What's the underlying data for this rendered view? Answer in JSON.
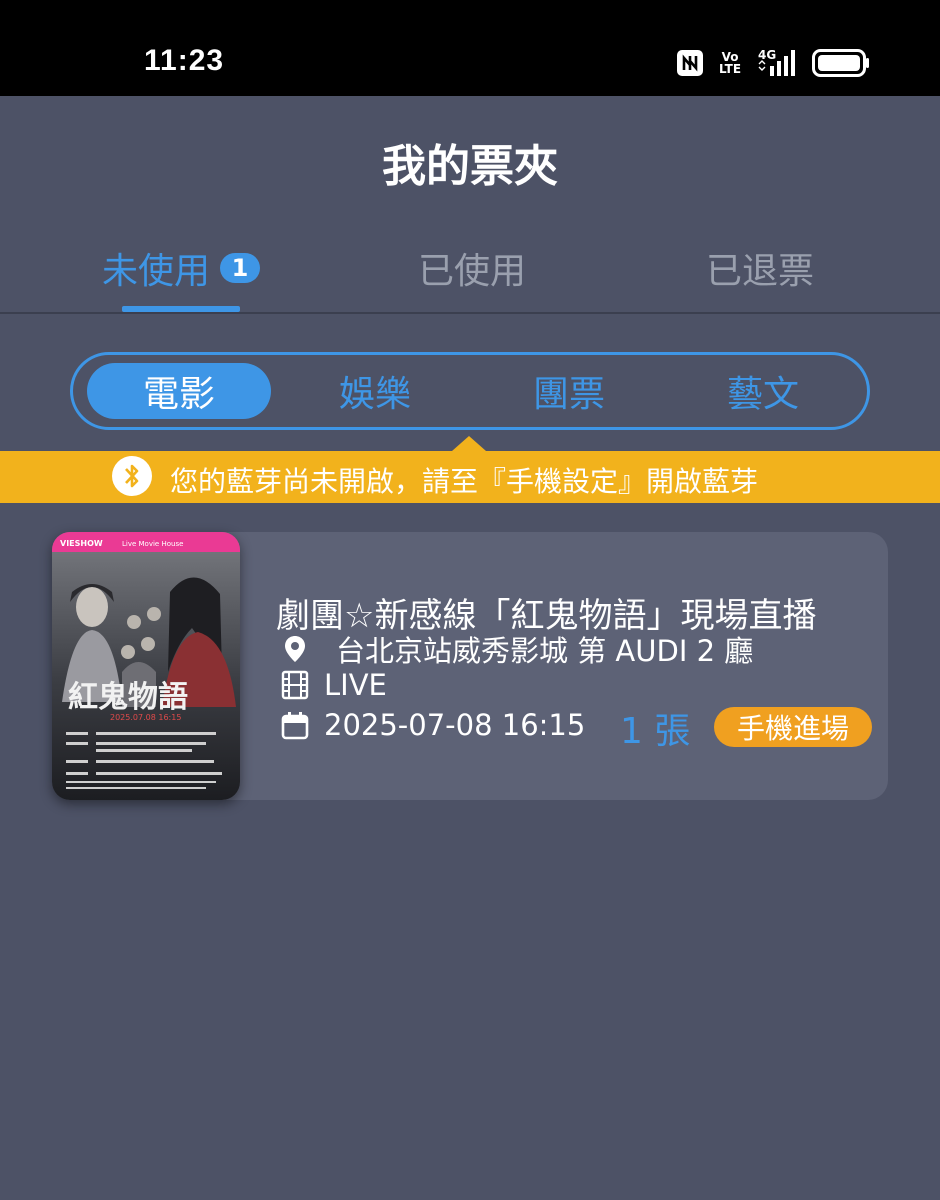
{
  "status_bar": {
    "time": "11:23",
    "network_lines": [
      "Vo",
      "LTE"
    ],
    "signal_label": "4G",
    "icons": [
      "nfc-icon",
      "volte-icon",
      "signal-icon",
      "battery-icon"
    ]
  },
  "header": {
    "title": "我的票夾"
  },
  "tabs": [
    {
      "label": "未使用",
      "badge": "1",
      "selected": true
    },
    {
      "label": "已使用",
      "selected": false
    },
    {
      "label": "已退票",
      "selected": false
    }
  ],
  "categories": [
    {
      "label": "電影",
      "selected": true
    },
    {
      "label": "娛樂",
      "selected": false
    },
    {
      "label": "團票",
      "selected": false
    },
    {
      "label": "藝文",
      "selected": false
    }
  ],
  "notice": {
    "icon": "bluetooth-icon",
    "text": "您的藍芽尚未開啟，請至『手機設定』開啟藍芽"
  },
  "tickets": [
    {
      "title": "劇團☆新感線「紅鬼物語」現場直播",
      "venue": "台北京站威秀影城 第 AUDI 2 廳",
      "format": "LIVE",
      "datetime": "2025-07-08 16:15",
      "quantity": "1 張",
      "entry_method": "手機進場",
      "poster": {
        "brand": "VIESHOW",
        "house": "Live Movie House",
        "title": "紅鬼物語",
        "date": "2025.07.08 16:15"
      }
    }
  ],
  "colors": {
    "background": "#4d5266",
    "accent": "#3e96e6",
    "notice": "#f2b21c",
    "entry_badge": "#f0a020"
  }
}
